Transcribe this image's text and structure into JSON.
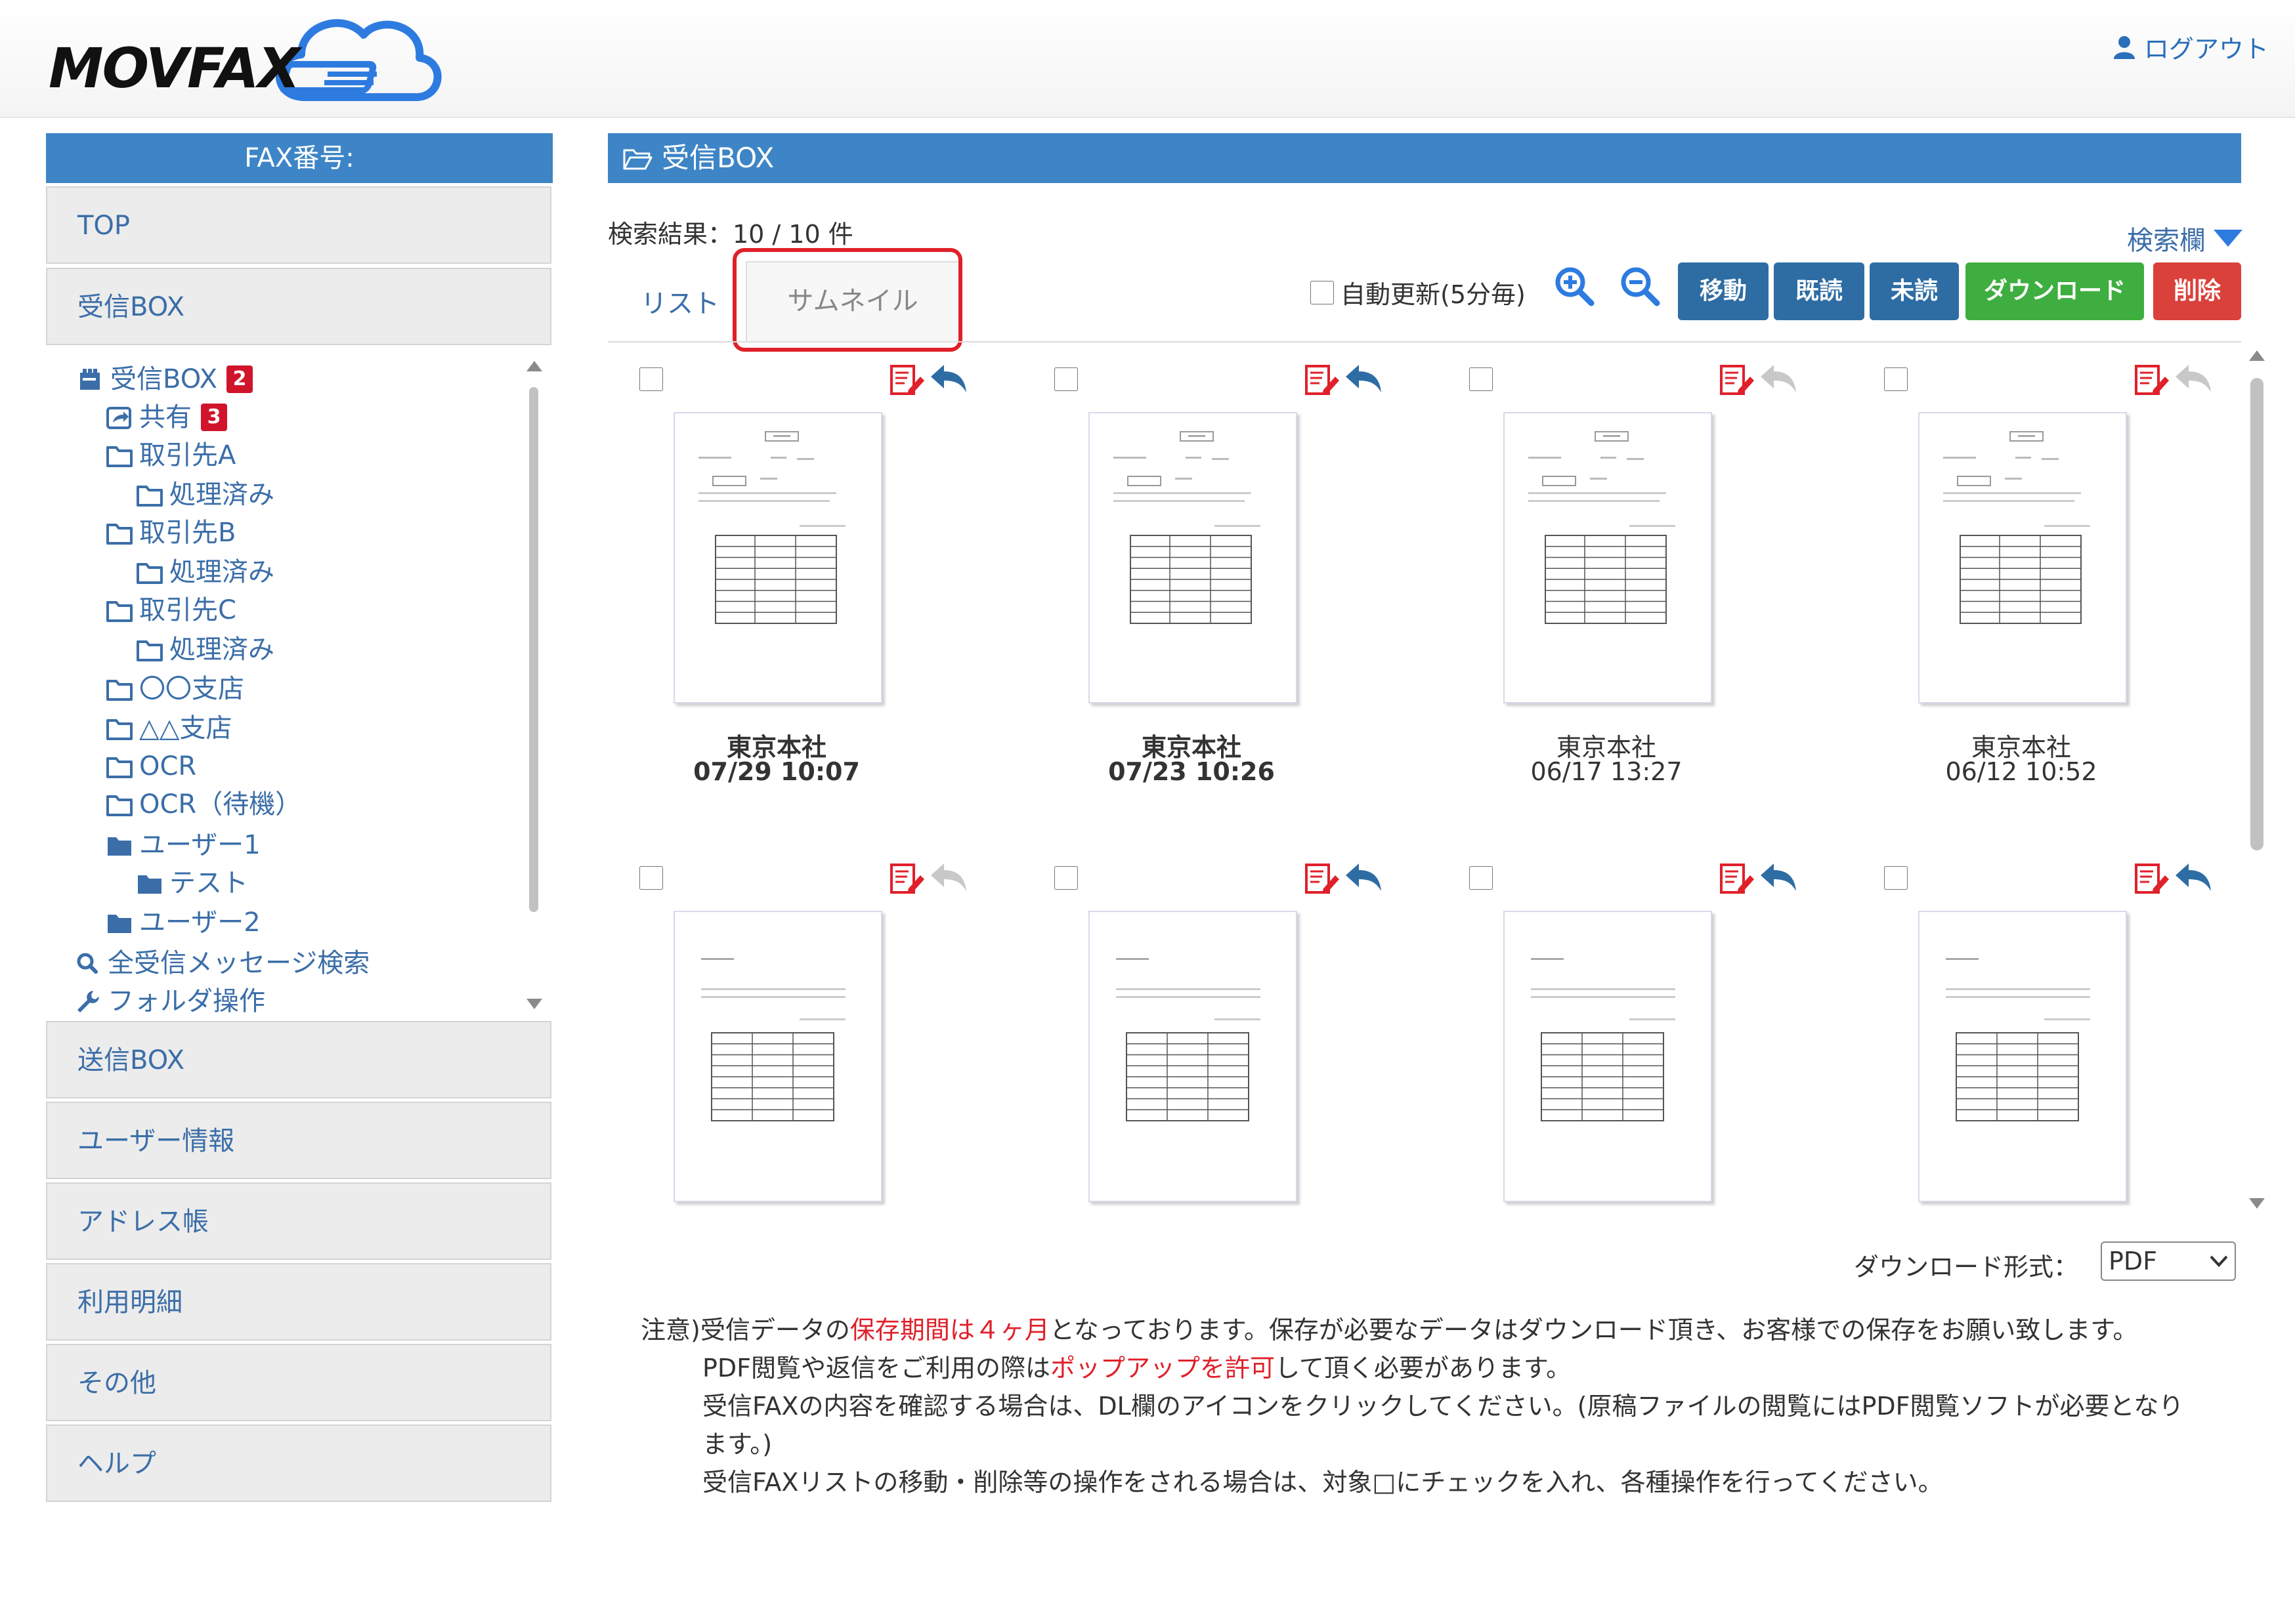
{
  "header": {
    "logo": "MOVFAX",
    "logout_label": "ログアウト"
  },
  "sidebar": {
    "fax_number_label": "FAX番号:",
    "nav_top": [
      "TOP",
      "受信BOX"
    ],
    "tree": [
      {
        "label": "受信BOX",
        "icon": "inbox-icon",
        "badge": "2"
      },
      {
        "label": "共有",
        "icon": "shared-folder-icon",
        "badge": "3"
      },
      {
        "label": "取引先A",
        "icon": "folder-outline-icon"
      },
      {
        "label": "処理済み",
        "icon": "folder-outline-icon"
      },
      {
        "label": "取引先B",
        "icon": "folder-outline-icon"
      },
      {
        "label": "処理済み",
        "icon": "folder-outline-icon"
      },
      {
        "label": "取引先C",
        "icon": "folder-outline-icon"
      },
      {
        "label": "処理済み",
        "icon": "folder-outline-icon"
      },
      {
        "label": "〇〇支店",
        "icon": "folder-outline-icon"
      },
      {
        "label": "△△支店",
        "icon": "folder-outline-icon"
      },
      {
        "label": "OCR",
        "icon": "folder-outline-icon"
      },
      {
        "label": "OCR（待機）",
        "icon": "folder-outline-icon"
      },
      {
        "label": "ユーザー1",
        "icon": "folder-solid-icon"
      },
      {
        "label": "テスト",
        "icon": "folder-solid-icon"
      },
      {
        "label": "ユーザー2",
        "icon": "folder-solid-icon"
      },
      {
        "label": "全受信メッセージ検索",
        "icon": "search-icon"
      },
      {
        "label": "フォルダ操作",
        "icon": "wrench-icon"
      }
    ],
    "nav_bottom": [
      "送信BOX",
      "ユーザー情報",
      "アドレス帳",
      "利用明細",
      "その他",
      "ヘルプ"
    ]
  },
  "main": {
    "title": "受信BOX",
    "result_text": "検索結果：10 / 10 件",
    "search_toggle": "検索欄",
    "tabs": [
      "リスト",
      "サムネイル"
    ],
    "auto_refresh_label": "自動更新(5分毎)",
    "buttons": {
      "move": "移動",
      "read": "既読",
      "unread": "未読",
      "download": "ダウンロード",
      "delete": "削除"
    },
    "cards": [
      {
        "name": "東京本社",
        "date": "07/29 10:07",
        "unread": true
      },
      {
        "name": "東京本社",
        "date": "07/23 10:26",
        "unread": true
      },
      {
        "name": "東京本社",
        "date": "06/17 13:27",
        "unread": false
      },
      {
        "name": "東京本社",
        "date": "06/12 10:52",
        "unread": false
      },
      {
        "name": "",
        "date": ""
      },
      {
        "name": "",
        "date": ""
      },
      {
        "name": "",
        "date": ""
      },
      {
        "name": "",
        "date": ""
      }
    ],
    "download_format_label": "ダウンロード形式：",
    "download_format_value": "PDF",
    "notes": {
      "n1_a": "注意)受信データの",
      "n1_red": "保存期間は４ヶ月",
      "n1_b": "となっております。保存が必要なデータはダウンロード頂き、お客様での保存をお願い致します。",
      "n2_a": "PDF閲覧や返信をご利用の際は",
      "n2_red": "ポップアップを許可",
      "n2_b": "して頂く必要があります。",
      "n3": "受信FAXの内容を確認する場合は、DL欄のアイコンをクリックしてください。(原稿ファイルの閲覧にはPDF閲覧ソフトが必要となります。)",
      "n4": "受信FAXリストの移動・削除等の操作をされる場合は、対象□にチェックを入れ、各種操作を行ってください。"
    }
  },
  "colors": {
    "accent_blue": "#3d85c6",
    "link_blue": "#3b6ea8",
    "badge_red": "#d0142c",
    "download_green": "#3fae40",
    "delete_red": "#d9413a",
    "highlight_red": "#e0202a"
  }
}
